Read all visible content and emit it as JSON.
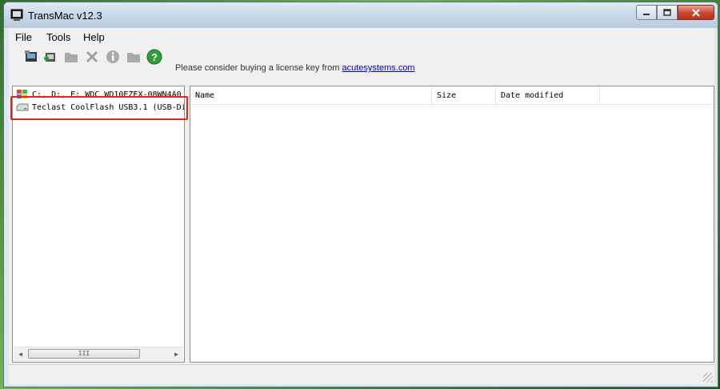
{
  "window": {
    "title": "TransMac v12.3"
  },
  "menu": {
    "items": [
      "File",
      "Tools",
      "Help"
    ]
  },
  "toolbar": {
    "icons": [
      "open-image-icon",
      "add-icon",
      "folder-icon",
      "delete-icon",
      "info-icon",
      "new-folder-icon",
      "help-icon"
    ],
    "nag_text": "Please consider buying a license key from",
    "nag_link": "acutesystems.com"
  },
  "tree": {
    "items": [
      {
        "label": "C:, D:, E: WDC WD10EZEX-08WN4A0 (S",
        "icon": "windows-drive-icon"
      },
      {
        "label": "Teclast CoolFlash USB3.1 (USB-Di",
        "icon": "usb-drive-icon"
      }
    ],
    "scroll_grip": "III"
  },
  "list": {
    "columns": [
      "Name",
      "Size",
      "Date modified"
    ]
  },
  "colors": {
    "highlight": "#e8221b",
    "link": "#0000cc"
  }
}
